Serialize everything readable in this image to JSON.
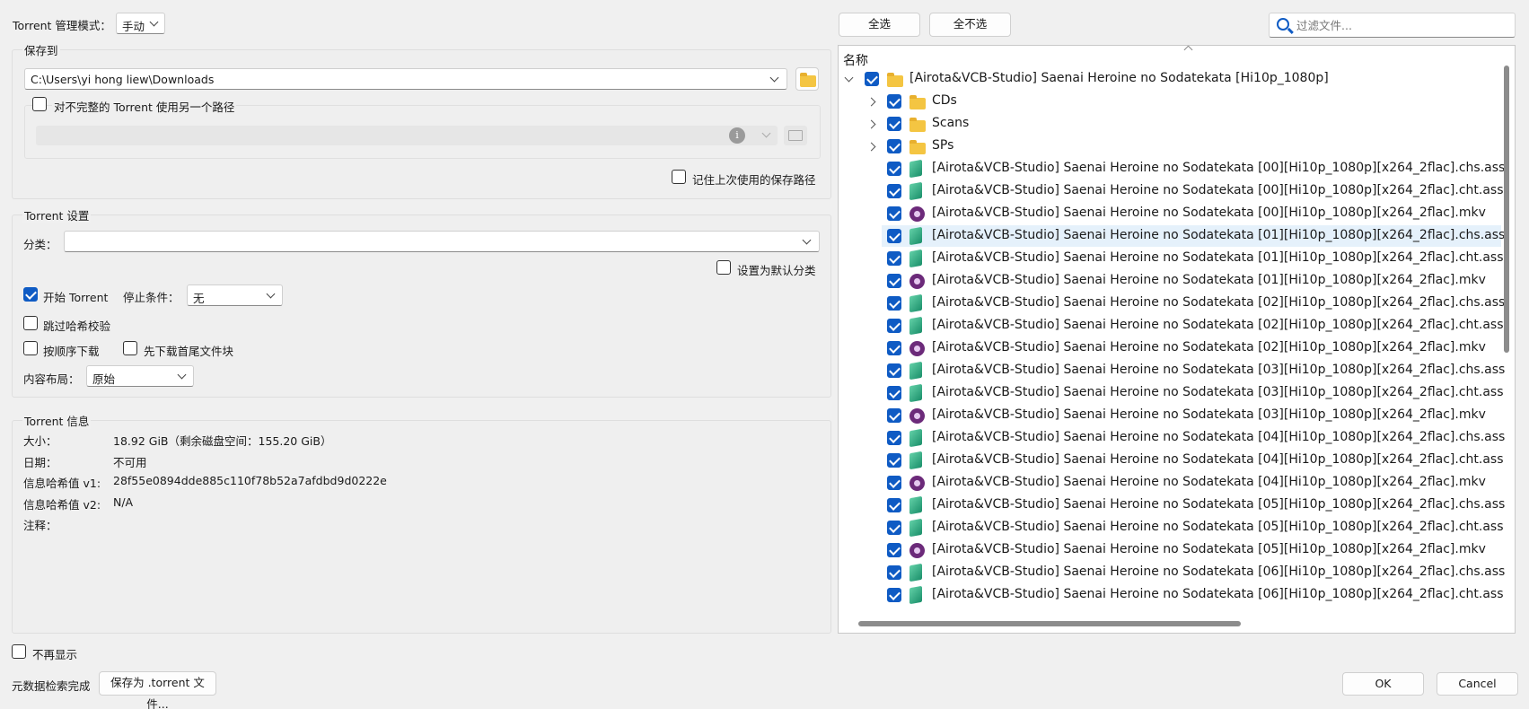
{
  "mode": {
    "label": "Torrent 管理模式：",
    "value": "手动"
  },
  "save": {
    "group_title": "保存到",
    "path": "C:\\Users\\yi hong liew\\Downloads",
    "alt_path_label": "对不完整的 Torrent 使用另一个路径",
    "remember_label": "记住上次使用的保存路径"
  },
  "settings": {
    "group_title": "Torrent 设置",
    "category_label": "分类：",
    "category_value": "",
    "default_category_label": "设置为默认分类",
    "start_label": "开始 Torrent",
    "stop_label": "停止条件：",
    "stop_value": "无",
    "skip_hash_label": "跳过哈希校验",
    "sequential_label": "按顺序下载",
    "first_last_label": "先下载首尾文件块",
    "layout_label": "内容布局：",
    "layout_value": "原始"
  },
  "info": {
    "group_title": "Torrent 信息",
    "rows": [
      {
        "label": "大小：",
        "value": "18.92 GiB（剩余磁盘空间：155.20 GiB）"
      },
      {
        "label": "日期：",
        "value": "不可用"
      },
      {
        "label": "信息哈希值 v1:",
        "value": "28f55e0894dde885c110f78b52a7afdbd9d0222e"
      },
      {
        "label": "信息哈希值 v2:",
        "value": "N/A"
      },
      {
        "label": "注释：",
        "value": ""
      }
    ]
  },
  "footer": {
    "dont_show_label": "不再显示",
    "status": "元数据检索完成",
    "save_torrent_label": "保存为 .torrent 文件...",
    "ok_label": "OK",
    "cancel_label": "Cancel"
  },
  "files": {
    "select_all_label": "全选",
    "select_none_label": "全不选",
    "filter_placeholder": "过滤文件...",
    "column_name": "名称",
    "root": "[Airota&VCB-Studio] Saenai Heroine no Sodatekata [Hi10p_1080p]",
    "folders": [
      "CDs",
      "Scans",
      "SPs"
    ],
    "items": [
      {
        "name": "[Airota&VCB-Studio] Saenai Heroine no Sodatekata [00][Hi10p_1080p][x264_2flac].chs.ass",
        "icon": "subtitle-icon"
      },
      {
        "name": "[Airota&VCB-Studio] Saenai Heroine no Sodatekata [00][Hi10p_1080p][x264_2flac].cht.ass",
        "icon": "subtitle-icon"
      },
      {
        "name": "[Airota&VCB-Studio] Saenai Heroine no Sodatekata [00][Hi10p_1080p][x264_2flac].mkv",
        "icon": "video-icon"
      },
      {
        "name": "[Airota&VCB-Studio] Saenai Heroine no Sodatekata [01][Hi10p_1080p][x264_2flac].chs.ass",
        "icon": "subtitle-icon"
      },
      {
        "name": "[Airota&VCB-Studio] Saenai Heroine no Sodatekata [01][Hi10p_1080p][x264_2flac].cht.ass",
        "icon": "subtitle-icon"
      },
      {
        "name": "[Airota&VCB-Studio] Saenai Heroine no Sodatekata [01][Hi10p_1080p][x264_2flac].mkv",
        "icon": "video-icon"
      },
      {
        "name": "[Airota&VCB-Studio] Saenai Heroine no Sodatekata [02][Hi10p_1080p][x264_2flac].chs.ass",
        "icon": "subtitle-icon"
      },
      {
        "name": "[Airota&VCB-Studio] Saenai Heroine no Sodatekata [02][Hi10p_1080p][x264_2flac].cht.ass",
        "icon": "subtitle-icon"
      },
      {
        "name": "[Airota&VCB-Studio] Saenai Heroine no Sodatekata [02][Hi10p_1080p][x264_2flac].mkv",
        "icon": "video-icon"
      },
      {
        "name": "[Airota&VCB-Studio] Saenai Heroine no Sodatekata [03][Hi10p_1080p][x264_2flac].chs.ass",
        "icon": "subtitle-icon"
      },
      {
        "name": "[Airota&VCB-Studio] Saenai Heroine no Sodatekata [03][Hi10p_1080p][x264_2flac].cht.ass",
        "icon": "subtitle-icon"
      },
      {
        "name": "[Airota&VCB-Studio] Saenai Heroine no Sodatekata [03][Hi10p_1080p][x264_2flac].mkv",
        "icon": "video-icon"
      },
      {
        "name": "[Airota&VCB-Studio] Saenai Heroine no Sodatekata [04][Hi10p_1080p][x264_2flac].chs.ass",
        "icon": "subtitle-icon"
      },
      {
        "name": "[Airota&VCB-Studio] Saenai Heroine no Sodatekata [04][Hi10p_1080p][x264_2flac].cht.ass",
        "icon": "subtitle-icon"
      },
      {
        "name": "[Airota&VCB-Studio] Saenai Heroine no Sodatekata [04][Hi10p_1080p][x264_2flac].mkv",
        "icon": "video-icon"
      },
      {
        "name": "[Airota&VCB-Studio] Saenai Heroine no Sodatekata [05][Hi10p_1080p][x264_2flac].chs.ass",
        "icon": "subtitle-icon"
      },
      {
        "name": "[Airota&VCB-Studio] Saenai Heroine no Sodatekata [05][Hi10p_1080p][x264_2flac].cht.ass",
        "icon": "subtitle-icon"
      },
      {
        "name": "[Airota&VCB-Studio] Saenai Heroine no Sodatekata [05][Hi10p_1080p][x264_2flac].mkv",
        "icon": "video-icon"
      },
      {
        "name": "[Airota&VCB-Studio] Saenai Heroine no Sodatekata [06][Hi10p_1080p][x264_2flac].chs.ass",
        "icon": "subtitle-icon"
      },
      {
        "name": "[Airota&VCB-Studio] Saenai Heroine no Sodatekata [06][Hi10p_1080p][x264_2flac].cht.ass",
        "icon": "subtitle-icon"
      }
    ]
  },
  "colors": {
    "accent": "#0f5bc4",
    "folder": "#f4c542",
    "video": "#6c2a7a",
    "subtitle": "#1a8f6a",
    "hover_row": "#e5f1fb"
  }
}
